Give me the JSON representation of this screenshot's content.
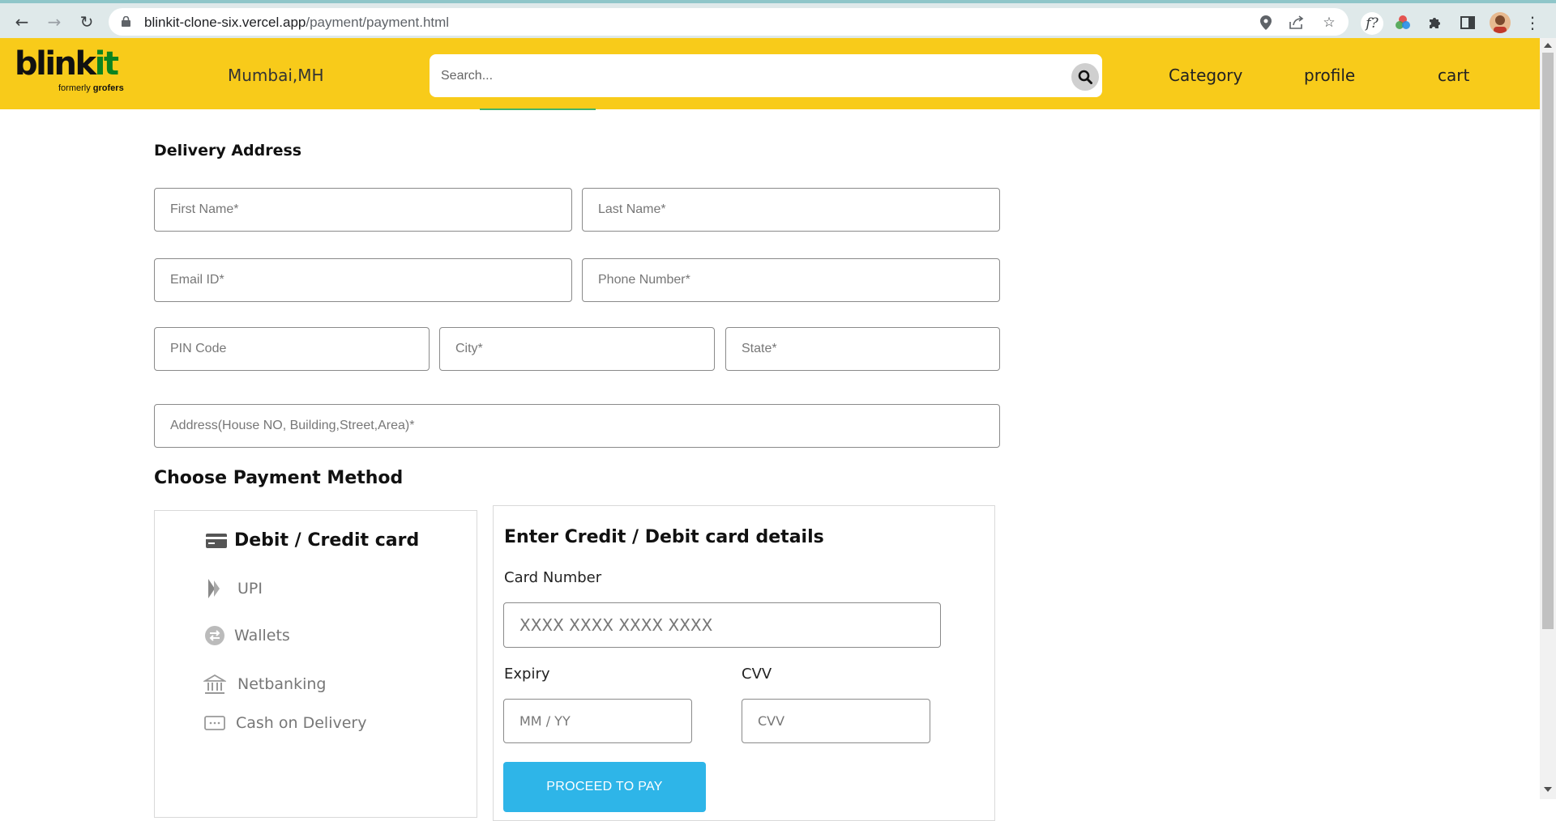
{
  "browser": {
    "url_host": "blinkit-clone-six.vercel.app",
    "url_path": "/payment/payment.html"
  },
  "header": {
    "logo_main": "blink",
    "logo_accent": "it",
    "logo_sub_prefix": "formerly",
    "logo_sub_brand": "grofers",
    "location": "Mumbai,MH",
    "search_placeholder": "Search...",
    "nav": [
      "Category",
      "profile",
      "cart"
    ]
  },
  "delivery": {
    "title": "Delivery Address",
    "first_name_placeholder": "First Name*",
    "last_name_placeholder": "Last Name*",
    "email_placeholder": "Email ID*",
    "phone_placeholder": "Phone Number*",
    "pin_placeholder": "PIN Code",
    "city_placeholder": "City*",
    "state_placeholder": "State*",
    "address_placeholder": "Address(House NO, Building,Street,Area)*"
  },
  "payment": {
    "title": "Choose Payment Method",
    "methods": [
      {
        "label": "Debit / Credit card",
        "icon": "credit-card-icon",
        "active": true
      },
      {
        "label": "UPI",
        "icon": "upi-icon",
        "active": false
      },
      {
        "label": "Wallets",
        "icon": "wallet-icon",
        "active": false
      },
      {
        "label": "Netbanking",
        "icon": "bank-icon",
        "active": false
      },
      {
        "label": "Cash on Delivery",
        "icon": "cash-icon",
        "active": false
      }
    ],
    "card": {
      "title": "Enter Credit / Debit card details",
      "number_label": "Card Number",
      "number_placeholder": "XXXX XXXX XXXX XXXX",
      "expiry_label": "Expiry",
      "expiry_placeholder": "MM / YY",
      "cvv_label": "CVV",
      "cvv_placeholder": "CVV",
      "pay_button": "PROCEED TO PAY"
    }
  },
  "colors": {
    "header_bg": "#f8cb1a",
    "brand_green": "#0c831f",
    "pay_button": "#2eb5e8"
  }
}
